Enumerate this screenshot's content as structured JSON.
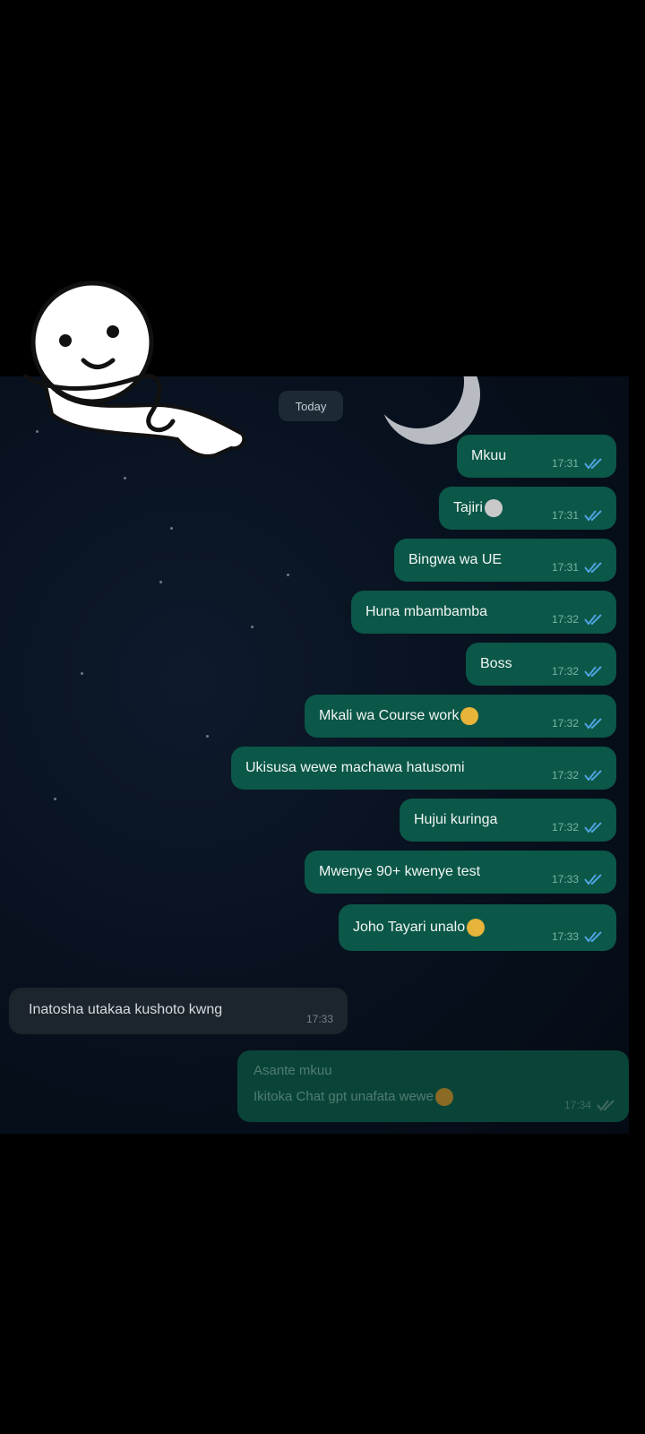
{
  "date_label": "Today",
  "outgoing": [
    {
      "text": "Mkuu",
      "time": "17:31",
      "emoji": ""
    },
    {
      "text": "Tajiri",
      "time": "17:31",
      "emoji": "money-face"
    },
    {
      "text": "Bingwa wa UE",
      "time": "17:31",
      "emoji": ""
    },
    {
      "text": "Huna mbambamba",
      "time": "17:32",
      "emoji": ""
    },
    {
      "text": "Boss",
      "time": "17:32",
      "emoji": ""
    },
    {
      "text": "Mkali wa Course work",
      "time": "17:32",
      "emoji": "raised-hands"
    },
    {
      "text": "Ukisusa wewe machawa hatusomi",
      "time": "17:32",
      "emoji": ""
    },
    {
      "text": "Hujui kuringa",
      "time": "17:32",
      "emoji": ""
    },
    {
      "text": "Mwenye 90+ kwenye test",
      "time": "17:33",
      "emoji": ""
    },
    {
      "text": "Joho Tayari unalo",
      "time": "17:33",
      "emoji": "ok-hand"
    }
  ],
  "incoming": {
    "text": "Inatosha utakaa kushoto kwng",
    "time": "17:33"
  },
  "last_outgoing": {
    "line1": "Asante mkuu",
    "line2": "Ikitoka Chat gpt unafata wewe",
    "time": "17:34",
    "emoji": "grinning-face"
  },
  "colors": {
    "outgoing_bubble": "#0b5748",
    "incoming_bubble": "#1c242c",
    "read_tick": "#4fa3e0",
    "background": "#000000"
  }
}
